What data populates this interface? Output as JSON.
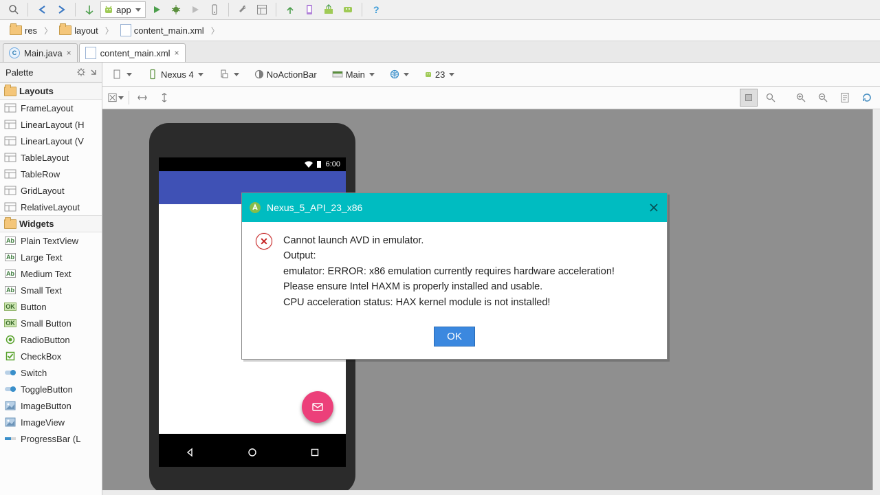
{
  "toolbar": {
    "app_dropdown_label": "app"
  },
  "breadcrumbs": {
    "items": [
      "res",
      "layout",
      "content_main.xml"
    ]
  },
  "editor_tabs": [
    {
      "label": "Main.java",
      "type": "java",
      "active": false
    },
    {
      "label": "content_main.xml",
      "type": "xml",
      "active": true
    }
  ],
  "palette": {
    "title": "Palette",
    "categories": [
      {
        "name": "Layouts",
        "items": [
          "FrameLayout",
          "LinearLayout (H",
          "LinearLayout (V",
          "TableLayout",
          "TableRow",
          "GridLayout",
          "RelativeLayout"
        ]
      },
      {
        "name": "Widgets",
        "items": [
          "Plain TextView",
          "Large Text",
          "Medium Text",
          "Small Text",
          "Button",
          "Small Button",
          "RadioButton",
          "CheckBox",
          "Switch",
          "ToggleButton",
          "ImageButton",
          "ImageView",
          "ProgressBar (L"
        ]
      }
    ]
  },
  "design_toolbar": {
    "device_label": "Nexus 4",
    "theme_label": "NoActionBar",
    "context_label": "Main",
    "api_label": "23"
  },
  "phone": {
    "clock": "6:00"
  },
  "dialog": {
    "title": "Nexus_5_API_23_x86",
    "line1": "Cannot launch AVD in emulator.",
    "line2": "Output:",
    "line3": "emulator: ERROR: x86 emulation currently requires hardware acceleration!",
    "line4": "Please ensure Intel HAXM is properly installed and usable.",
    "line5": "CPU acceleration status: HAX kernel module is not installed!",
    "ok": "OK"
  }
}
